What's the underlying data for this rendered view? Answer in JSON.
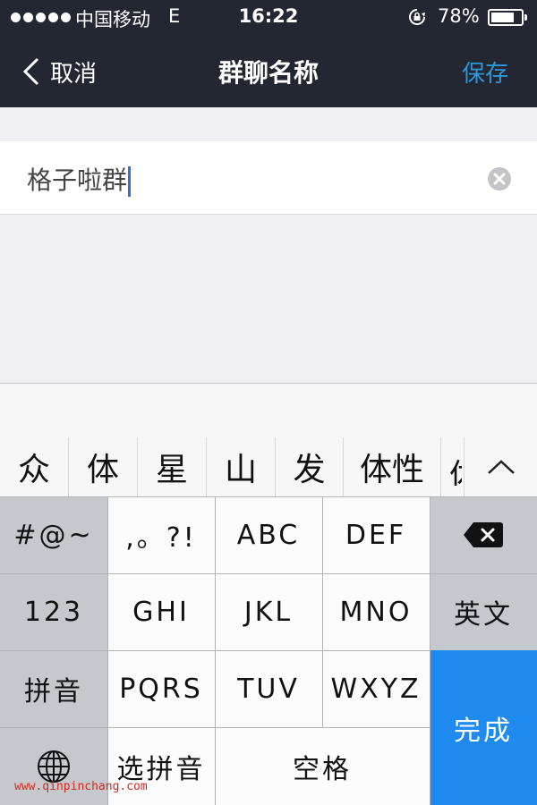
{
  "status_bar": {
    "carrier": "中国移动",
    "network": "E",
    "time": "16:22",
    "battery_percent_text": "78%",
    "battery_level": 0.78
  },
  "nav": {
    "back_label": "取消",
    "title": "群聊名称",
    "save_label": "保存"
  },
  "input": {
    "value": "格子啦群"
  },
  "keyboard": {
    "candidates": [
      "众",
      "体",
      "星",
      "山",
      "发",
      "体性"
    ],
    "keys": {
      "symbols": "#@~",
      "punct": ",。?!",
      "abc": "ABC",
      "def": "DEF",
      "num": "123",
      "ghi": "GHI",
      "jkl": "JKL",
      "mno": "MNO",
      "english": "英文",
      "pinyin": "拼音",
      "pqrs": "PQRS",
      "tuv": "TUV",
      "wxyz": "WXYZ",
      "done": "完成",
      "select_pinyin": "选拼音",
      "space": "空格"
    }
  },
  "watermark": "www.qinpinchang.com",
  "colors": {
    "bar_bg": "#232732",
    "accent": "#2f97d9",
    "done_key": "#1f8bf0"
  }
}
